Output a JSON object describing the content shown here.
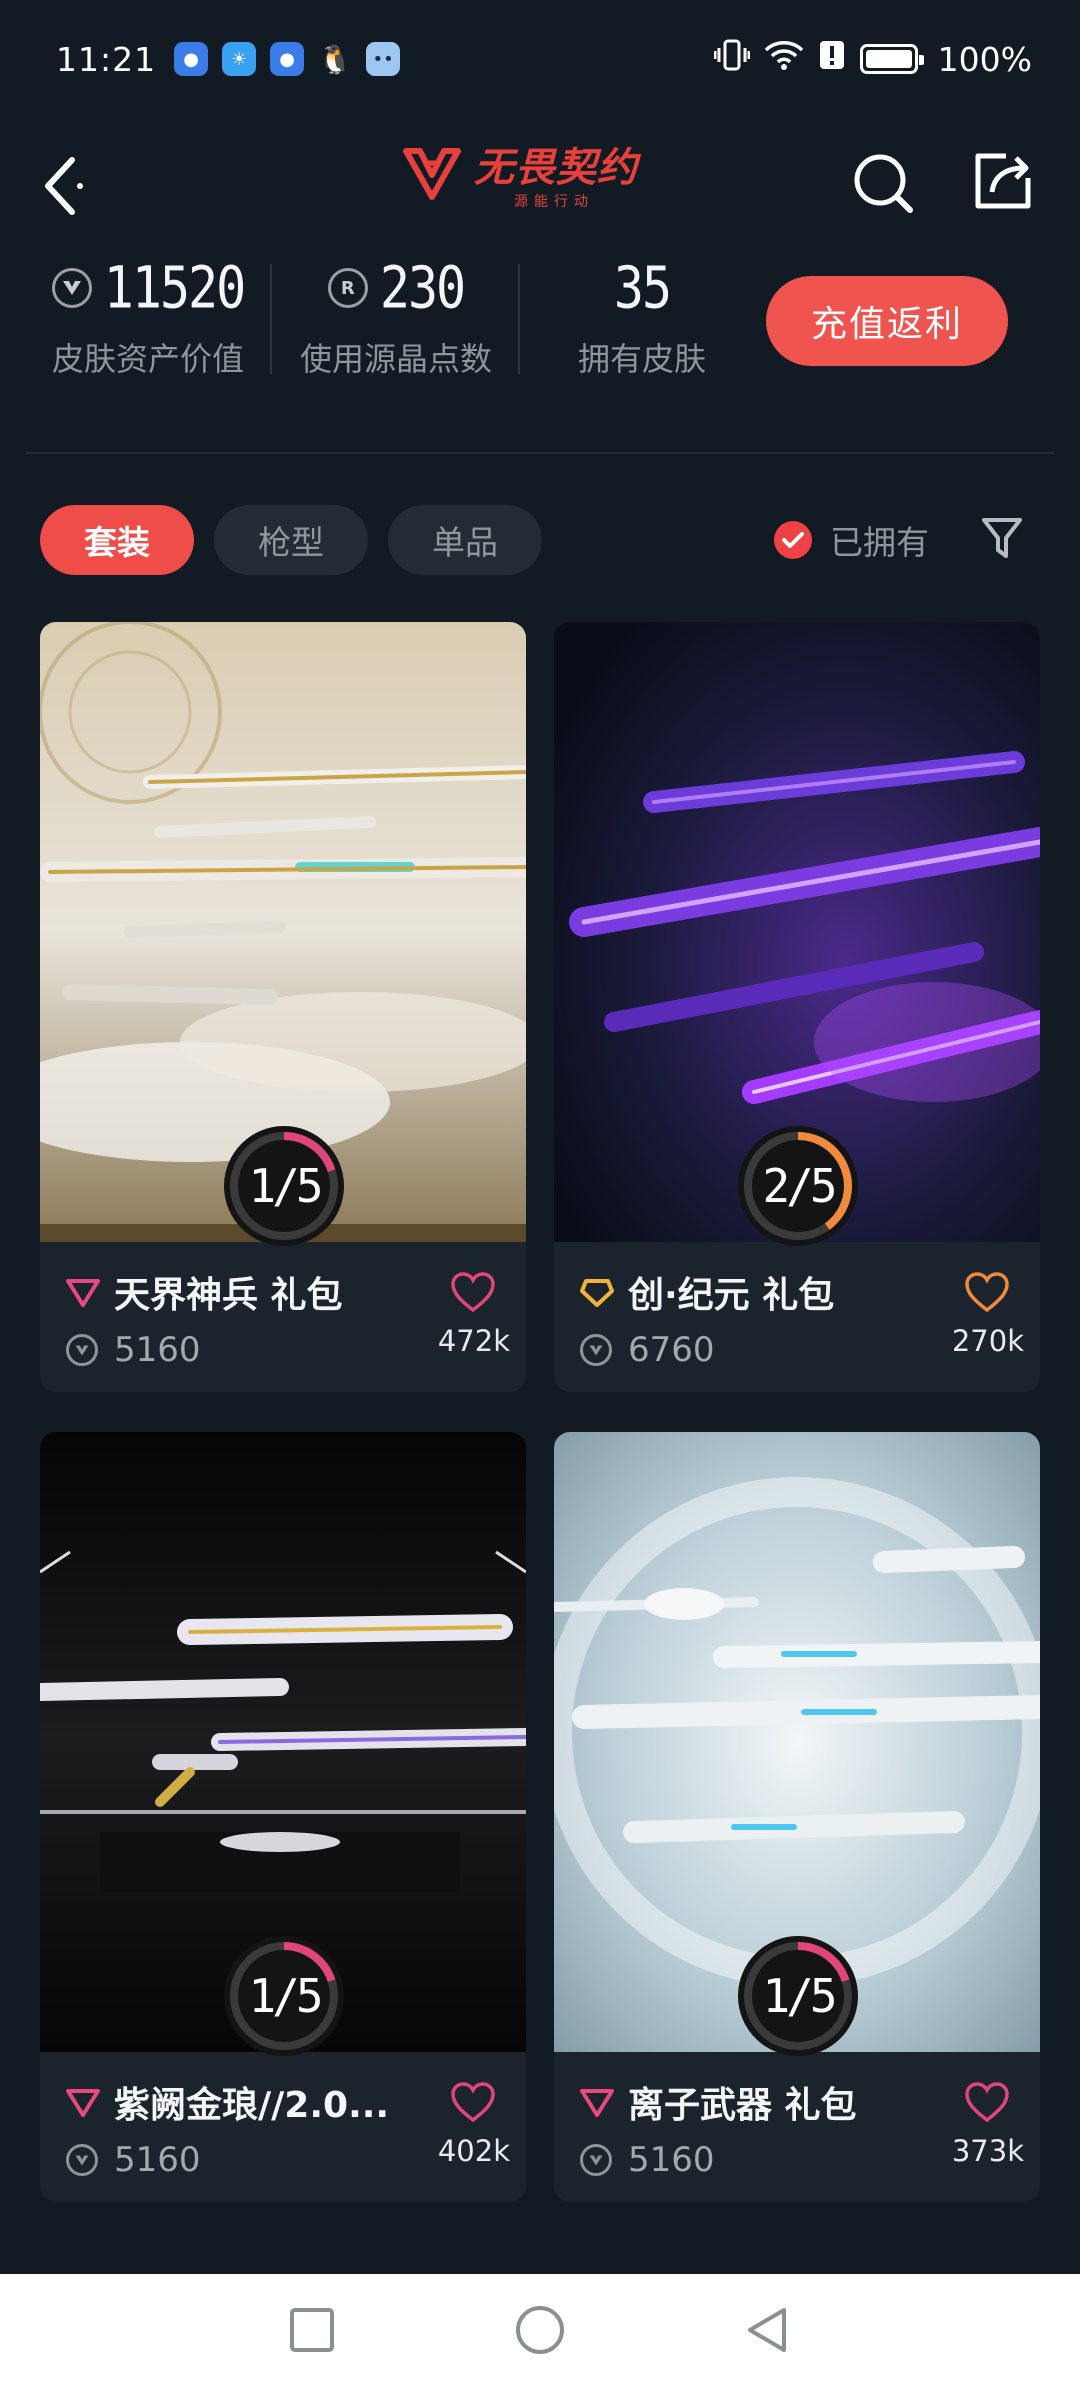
{
  "status_bar": {
    "time": "11:21",
    "battery": "100%",
    "notification_icons": [
      "app-icon",
      "weather-icon",
      "app-icon",
      "qq-icon",
      "chat-icon"
    ]
  },
  "nav": {
    "logo_title": "无畏契约",
    "logo_subtitle": "源能行动"
  },
  "stats": {
    "asset_value": "11520",
    "asset_label": "皮肤资产价值",
    "points_value": "230",
    "points_label": "使用源晶点数",
    "owned_value": "35",
    "owned_label": "拥有皮肤",
    "recharge_label": "充值返利"
  },
  "filters": {
    "tabs": [
      {
        "label": "套装",
        "active": true
      },
      {
        "label": "枪型",
        "active": false
      },
      {
        "label": "单品",
        "active": false
      }
    ],
    "owned_label": "已拥有",
    "owned_checked": true
  },
  "cards": [
    {
      "title": "天界神兵 礼包",
      "price": "5160",
      "likes": "472k",
      "progress": "1/5",
      "owned": 1,
      "total": 5,
      "ring_color": "#e0457b",
      "tier_color": "#e84a7f",
      "heart_color": "#e0457b"
    },
    {
      "title": "创·纪元 礼包",
      "price": "6760",
      "likes": "270k",
      "progress": "2/5",
      "owned": 2,
      "total": 5,
      "ring_color": "#f08a3c",
      "tier_color": "#f0b43a",
      "heart_color": "#f08a3c"
    },
    {
      "title": "紫阙金琅//2.0...",
      "price": "5160",
      "likes": "402k",
      "progress": "1/5",
      "owned": 1,
      "total": 5,
      "ring_color": "#e0457b",
      "tier_color": "#e84a7f",
      "heart_color": "#e0457b"
    },
    {
      "title": "离子武器 礼包",
      "price": "5160",
      "likes": "373k",
      "progress": "1/5",
      "owned": 1,
      "total": 5,
      "ring_color": "#e0457b",
      "tier_color": "#e84a7f",
      "heart_color": "#e0457b"
    }
  ],
  "colors": {
    "accent": "#ef4d47",
    "background": "#121a23",
    "card_bg": "#1b232c"
  }
}
